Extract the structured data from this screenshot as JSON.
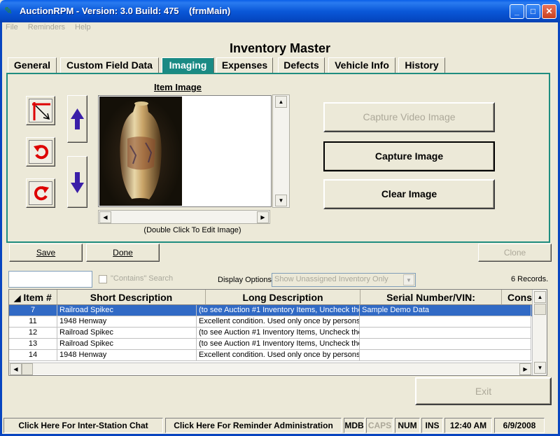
{
  "window": {
    "title": "AuctionRPM - Version: 3.0 Build: 475",
    "form_name": "(frmMain)",
    "minimize": "_",
    "maximize": "□",
    "close": "✕"
  },
  "menu": [
    "File",
    "Reminders",
    "Help"
  ],
  "page_title": "Inventory Master",
  "tabs": [
    {
      "label": "General"
    },
    {
      "label": "Custom Field Data"
    },
    {
      "label": "Imaging"
    },
    {
      "label": "Expenses"
    },
    {
      "label": "Defects"
    },
    {
      "label": "Vehicle Info"
    },
    {
      "label": "History"
    }
  ],
  "active_tab": "Imaging",
  "imaging": {
    "item_image_label": "Item Image",
    "hint": "(Double Click To Edit Image)",
    "capture_video_label": "Capture Video Image",
    "capture_image_label": "Capture Image",
    "clear_image_label": "Clear Image"
  },
  "actions": {
    "save_label": "Save",
    "done_label": "Done",
    "clone_label": "Clone",
    "exit_label": "Exit"
  },
  "filter": {
    "search_value": "",
    "contains_label": "\"Contains\" Search",
    "display_options_label": "Display Options:",
    "display_options_value": "Show Unassigned Inventory Only",
    "records_count": "6 Records."
  },
  "grid": {
    "columns": [
      "Item #",
      "Short Description",
      "Long Description",
      "Serial Number/VIN:",
      "Cons"
    ],
    "rows": [
      {
        "item": "7",
        "short": "Railroad Spikec",
        "long": "(to see Auction #1 Inventory Items, Uncheck the",
        "serial": "Sample Demo Data",
        "cons": "",
        "selected": true
      },
      {
        "item": "11",
        "short": "1948 Henway",
        "long": "Excellent condition.  Used only once by persons",
        "serial": "",
        "cons": ""
      },
      {
        "item": "12",
        "short": "Railroad Spikec",
        "long": "(to see Auction #1 Inventory Items, Uncheck the",
        "serial": "",
        "cons": ""
      },
      {
        "item": "13",
        "short": "Railroad Spikec",
        "long": "(to see Auction #1 Inventory Items, Uncheck the",
        "serial": "",
        "cons": ""
      },
      {
        "item": "14",
        "short": "1948 Henway",
        "long": "Excellent condition.  Used only once by persons",
        "serial": "",
        "cons": ""
      }
    ]
  },
  "statusbar": {
    "chat": "Click Here For Inter-Station Chat",
    "reminder": "Click Here For Reminder Administration",
    "mdb": "MDB",
    "caps": "CAPS",
    "num": "NUM",
    "ins": "INS",
    "time": "12:40 AM",
    "date": "6/9/2008"
  },
  "colors": {
    "titlebar": "#0a58d8",
    "active_tab": "#1a8a84",
    "selected_row": "#316ac5"
  }
}
